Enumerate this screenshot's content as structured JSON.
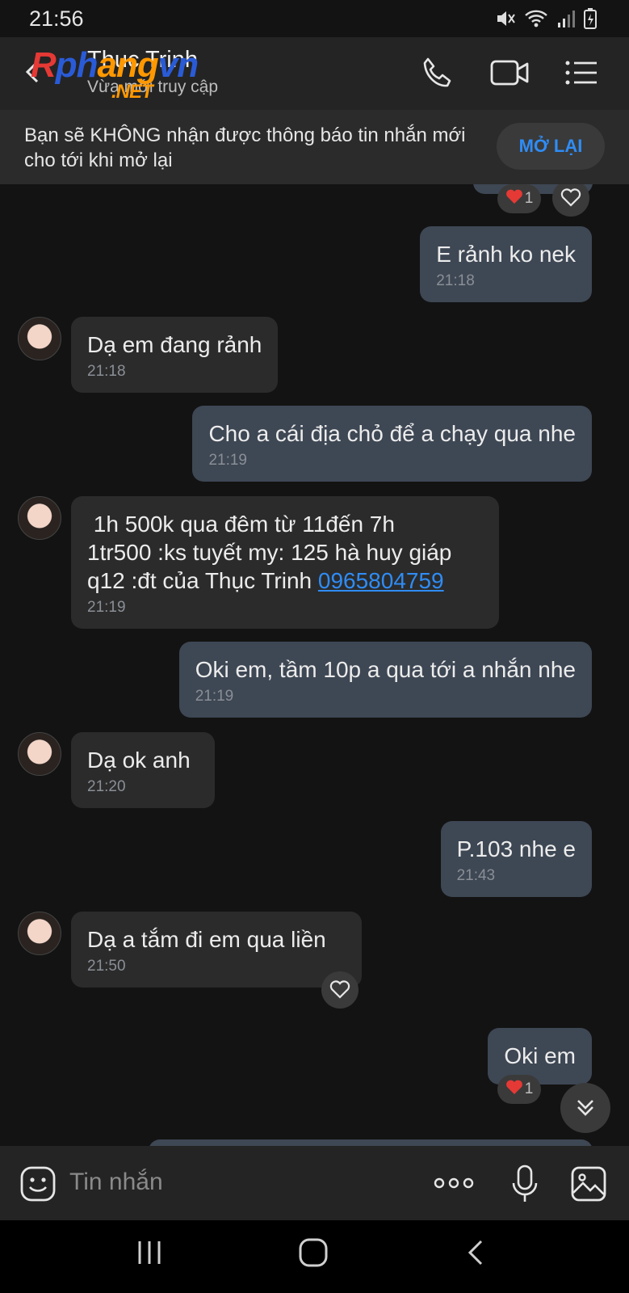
{
  "status_bar": {
    "time": "21:56"
  },
  "header": {
    "contact_name": "Thục Trinh",
    "contact_status": "Vừa mới truy cập",
    "watermark": "Rphangvn .NET"
  },
  "notice": {
    "text": "Bạn sẽ KHÔNG nhận được thông báo tin nhắn mới cho tới khi mở lại",
    "button": "MỞ LẠI"
  },
  "messages": [
    {
      "dir": "out",
      "text": "E rảnh ko nek",
      "time": "21:18"
    },
    {
      "dir": "in",
      "text": "Dạ em đang rảnh",
      "time": "21:18"
    },
    {
      "dir": "out",
      "text": "Cho a cái địa chỏ để a chạy qua nhe",
      "time": "21:19"
    },
    {
      "dir": "in",
      "line1": " 1h 500k qua đêm từ 11đến 7h",
      "line2": "1tr500 :ks tuyết my: 125 hà huy giáp",
      "line3": "q12 :đt của Thục Trinh ",
      "phone": "0965804759",
      "time": "21:19"
    },
    {
      "dir": "out",
      "text": "Oki em, tầm 10p a qua tới a nhắn nhe",
      "time": "21:19"
    },
    {
      "dir": "in",
      "text": "Dạ ok anh",
      "time": "21:20"
    },
    {
      "dir": "out",
      "text": "P.103 nhe e",
      "time": "21:43"
    },
    {
      "dir": "in",
      "text": "Dạ a tắm đi em qua liền",
      "time": "21:50"
    },
    {
      "dir": "out",
      "text": "Oki em",
      "time": ""
    }
  ],
  "reactions": {
    "top_count": "1",
    "bottom_count": "1"
  },
  "input": {
    "placeholder": "Tin nhắn"
  },
  "colors": {
    "accent": "#2f8cf5",
    "bubble_out": "#3e4754",
    "bubble_in": "#2b2b2b",
    "heart": "#e53935"
  }
}
